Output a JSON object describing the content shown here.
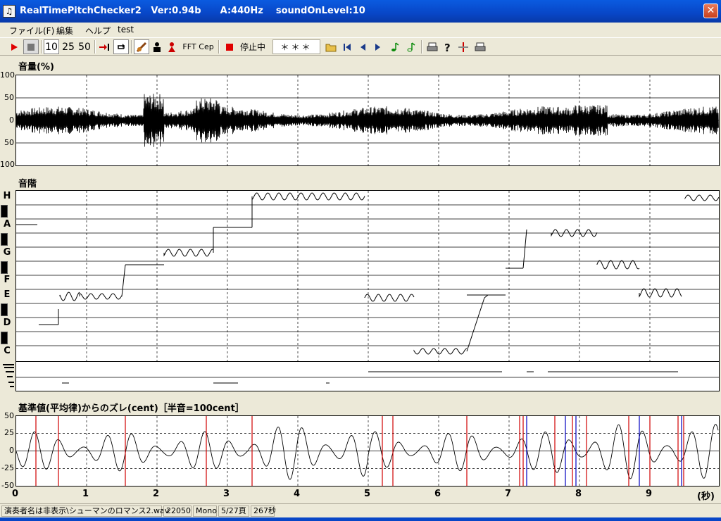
{
  "window": {
    "title": "RealTimePitchChecker2   Ver:0.94b      A:440Hz    soundOnLevel:10",
    "icon": "music-note-icon"
  },
  "menu": [
    "ファイル(F)",
    "編集",
    "ヘルプ",
    "test"
  ],
  "toolbar": {
    "n10": "10",
    "n25": "25",
    "n50": "50",
    "fft": "FFT",
    "cep": "Cep",
    "status": "停止中",
    "stars": "＊＊＊"
  },
  "volume": {
    "label": "音量(%)",
    "ticks": [
      "100",
      "50",
      "0",
      "50",
      "100"
    ]
  },
  "scale": {
    "label": "音階",
    "notes": [
      "H",
      "A",
      "G",
      "F",
      "E",
      "D",
      "C"
    ]
  },
  "deviation": {
    "label": "基準値(平均律)からのズレ(cent)［半音=100cent］",
    "ticks": [
      "50",
      "25",
      "0",
      "-25",
      "-50"
    ]
  },
  "xaxis": {
    "ticks": [
      "0",
      "1",
      "2",
      "3",
      "4",
      "5",
      "6",
      "7",
      "8",
      "9"
    ],
    "unit": "(秒)"
  },
  "status": {
    "file": "演奏者名は非表示\\シューマンのロマンス2.wav",
    "rate": "22050",
    "channels": "Mono",
    "page": "5/27頁",
    "duration": "267秒"
  }
}
